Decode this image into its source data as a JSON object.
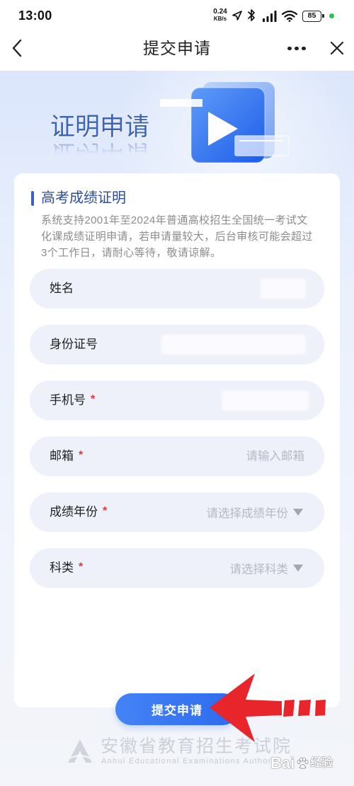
{
  "status_bar": {
    "time": "13:00",
    "net_speed_value": "0.24",
    "net_speed_unit": "KB/s",
    "battery_level": "85",
    "icons": [
      "location-icon",
      "bluetooth-icon",
      "signal-icon",
      "wifi-icon",
      "battery-icon"
    ]
  },
  "nav": {
    "title": "提交申请",
    "back_icon": "chevron-left-icon",
    "more_icon": "more-icon",
    "close_icon": "close-icon"
  },
  "banner": {
    "title": "证明申请",
    "illustration_icon": "play-icon"
  },
  "card": {
    "title": "高考成绩证明",
    "description_lines": [
      "系统支持2001年至2024年普通高校招生全国统一考试文",
      "化课成绩证明申请，若申请量较大，后台审核可能会超过",
      "3个工作日，请耐心等待，敬请谅解。"
    ]
  },
  "form": {
    "required_mark": "*",
    "fields": [
      {
        "label": "姓名",
        "required": false
      },
      {
        "label": "身份证号",
        "required": false
      },
      {
        "label": "手机号",
        "required": true
      },
      {
        "label": "邮箱",
        "required": true,
        "placeholder": "请输入邮箱"
      },
      {
        "label": "成绩年份",
        "required": true,
        "placeholder": "请选择成绩年份"
      },
      {
        "label": "科类",
        "required": true,
        "placeholder": "请选择科类"
      }
    ],
    "submit_label": "提交申请"
  },
  "footer": {
    "org_name": "安徽省教育招生考试院",
    "org_name_en": "Anhui Educational Examinations Authority"
  },
  "watermark": {
    "brand": "Bai",
    "suffix": "经验"
  },
  "colors": {
    "primary": "#2f6ff0",
    "required": "#e53935",
    "banner_title": "#3e64b4",
    "field_background": "#eef0fa",
    "annotation_arrow": "#e8252b",
    "status_dot": "#2bc15a"
  }
}
